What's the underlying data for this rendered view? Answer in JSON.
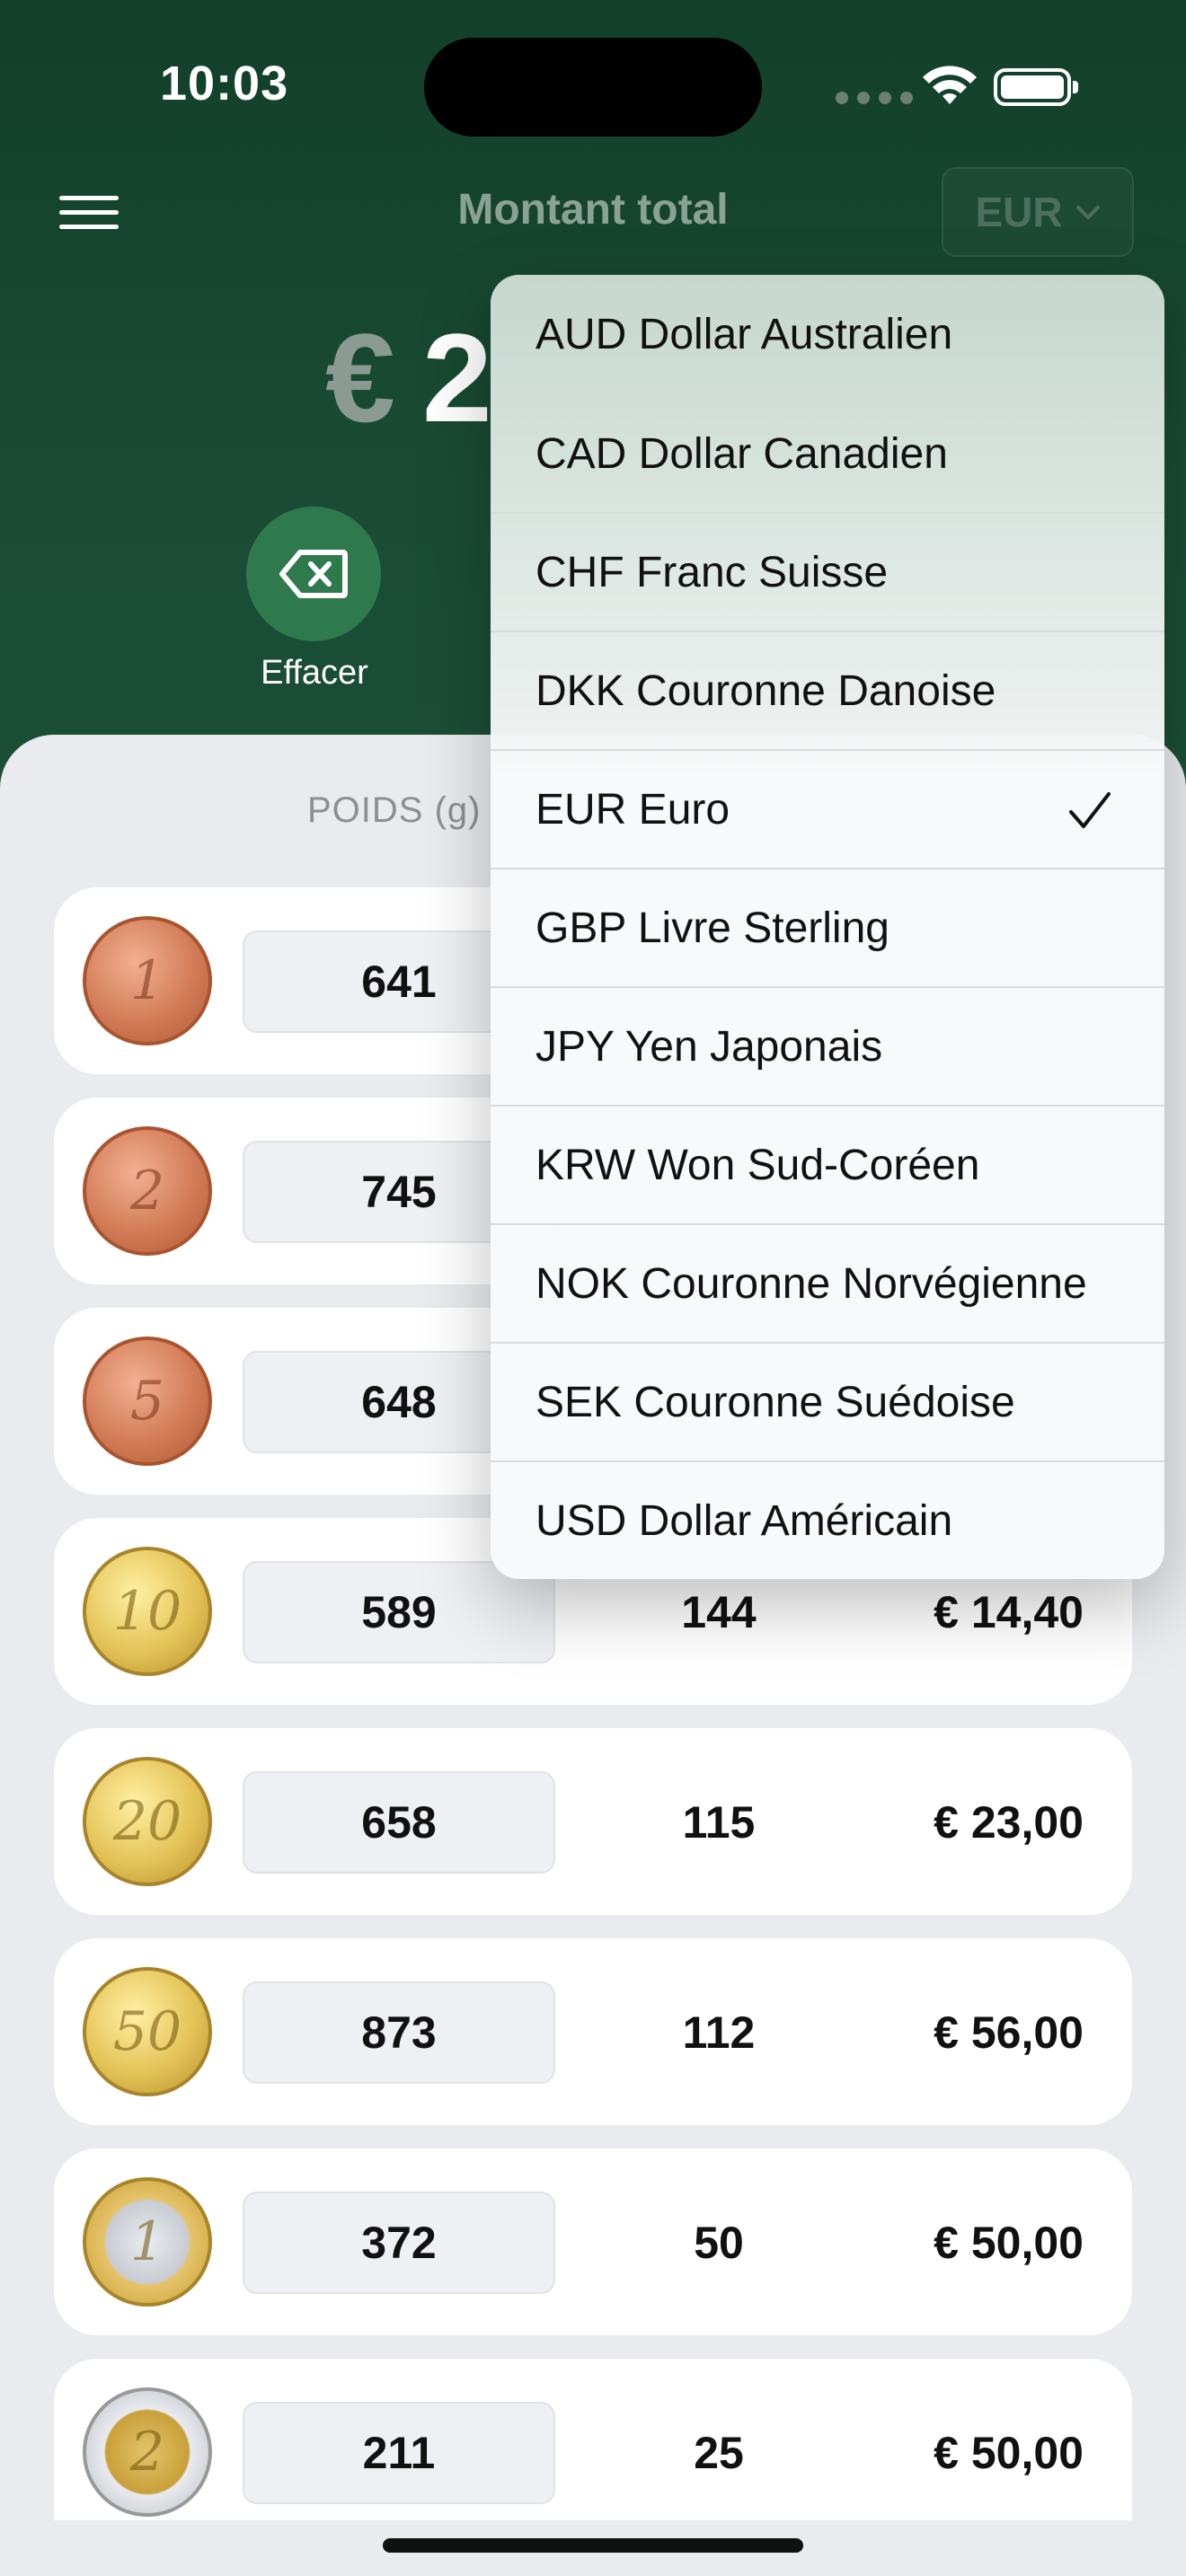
{
  "status_bar": {
    "time": "10:03"
  },
  "header": {
    "title": "Montant total",
    "currency_selected": "EUR",
    "total_currency_symbol": "€",
    "total_value": "2"
  },
  "actions": {
    "clear_label": "Effacer"
  },
  "table": {
    "column_header_weight": "POIDS (g)",
    "rows": [
      {
        "coin": "1-cent-coin",
        "mark": "1",
        "weight": "641",
        "count": "",
        "value": ""
      },
      {
        "coin": "2-cent-coin",
        "mark": "2",
        "weight": "745",
        "count": "",
        "value": ""
      },
      {
        "coin": "5-cent-coin",
        "mark": "5",
        "weight": "648",
        "count": "",
        "value": ""
      },
      {
        "coin": "10-cent-coin",
        "mark": "10",
        "weight": "589",
        "count": "144",
        "value": "€ 14,40"
      },
      {
        "coin": "20-cent-coin",
        "mark": "20",
        "weight": "658",
        "count": "115",
        "value": "€ 23,00"
      },
      {
        "coin": "50-cent-coin",
        "mark": "50",
        "weight": "873",
        "count": "112",
        "value": "€ 56,00"
      },
      {
        "coin": "1-euro-coin",
        "mark": "1",
        "weight": "372",
        "count": "50",
        "value": "€ 50,00"
      },
      {
        "coin": "2-euro-coin",
        "mark": "2",
        "weight": "211",
        "count": "25",
        "value": "€ 50,00"
      }
    ]
  },
  "currency_menu": {
    "items": [
      {
        "label": "AUD Dollar Australien"
      },
      {
        "label": "CAD Dollar Canadien"
      },
      {
        "label": "CHF Franc Suisse"
      },
      {
        "label": "DKK Couronne Danoise"
      },
      {
        "label": "EUR Euro",
        "checked": true
      },
      {
        "label": "GBP Livre Sterling"
      },
      {
        "label": "JPY Yen Japonais"
      },
      {
        "label": "KRW Won Sud-Coréen"
      },
      {
        "label": "NOK Couronne Norvégienne"
      },
      {
        "label": "SEK Couronne Suédoise"
      },
      {
        "label": "USD Dollar Américain"
      }
    ]
  },
  "colors": {
    "header_green": "#1a4c35",
    "clear_button_green": "#2f7a4d",
    "sheet_background": "#e9ebee"
  }
}
